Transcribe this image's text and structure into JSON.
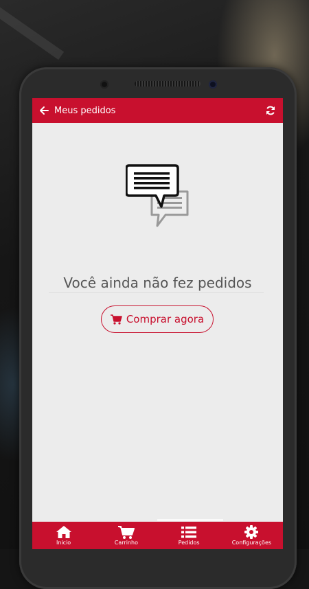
{
  "header": {
    "title": "Meus pedidos",
    "back_icon": "arrow-left-icon",
    "refresh_icon": "refresh-icon"
  },
  "empty_state": {
    "icon": "chat-bubbles-icon",
    "message": "Você ainda não fez pedidos",
    "button_label": "Comprar agora",
    "button_icon": "cart-icon"
  },
  "tabs": [
    {
      "label": "Inicio",
      "icon": "home-icon"
    },
    {
      "label": "Carrinho",
      "icon": "cart-icon"
    },
    {
      "label": "Pedidos",
      "icon": "list-icon"
    },
    {
      "label": "Configurações",
      "icon": "gear-icon"
    }
  ],
  "colors": {
    "accent": "#c8102e",
    "screen_bg": "#ececec"
  }
}
